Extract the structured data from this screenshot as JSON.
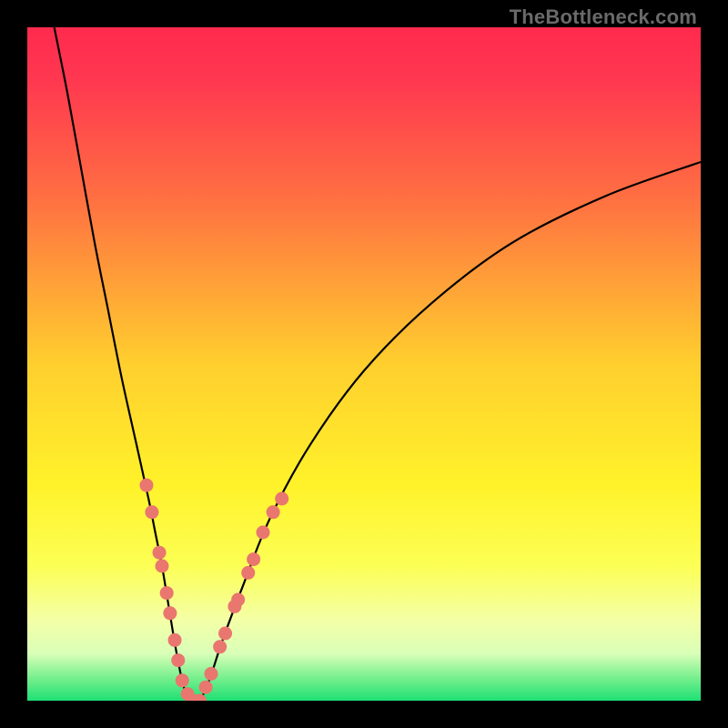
{
  "watermark": "TheBottleneck.com",
  "chart_data": {
    "type": "line",
    "title": "",
    "xlabel": "",
    "ylabel": "",
    "xlim": [
      0,
      100
    ],
    "ylim": [
      0,
      100
    ],
    "gradient_stops": [
      {
        "offset": 0,
        "color": "#ff2a4e"
      },
      {
        "offset": 0.08,
        "color": "#ff3850"
      },
      {
        "offset": 0.25,
        "color": "#ff6e42"
      },
      {
        "offset": 0.5,
        "color": "#ffcf2e"
      },
      {
        "offset": 0.68,
        "color": "#fff22a"
      },
      {
        "offset": 0.8,
        "color": "#fcff55"
      },
      {
        "offset": 0.88,
        "color": "#f4ffa6"
      },
      {
        "offset": 0.93,
        "color": "#d9ffb8"
      },
      {
        "offset": 0.965,
        "color": "#7af08f"
      },
      {
        "offset": 1.0,
        "color": "#1ee074"
      }
    ],
    "series": [
      {
        "name": "bottleneck-curve",
        "x": [
          4,
          6,
          8,
          10,
          12,
          14,
          16,
          18,
          19,
          20,
          21,
          22,
          23,
          24,
          25.5,
          27,
          29,
          32,
          36,
          42,
          50,
          60,
          72,
          86,
          100
        ],
        "values": [
          100,
          90,
          79,
          68,
          58,
          48,
          39,
          30,
          25,
          20,
          14,
          8,
          3,
          0,
          0,
          3,
          9,
          17,
          27,
          38,
          49,
          59,
          68,
          75,
          80
        ]
      }
    ],
    "highlight_dots": [
      {
        "x": 17.7,
        "y": 32
      },
      {
        "x": 18.5,
        "y": 28
      },
      {
        "x": 19.6,
        "y": 22
      },
      {
        "x": 20.0,
        "y": 20
      },
      {
        "x": 20.7,
        "y": 16
      },
      {
        "x": 21.2,
        "y": 13
      },
      {
        "x": 21.9,
        "y": 9
      },
      {
        "x": 22.4,
        "y": 6
      },
      {
        "x": 23.0,
        "y": 3
      },
      {
        "x": 23.8,
        "y": 1
      },
      {
        "x": 24.6,
        "y": 0
      },
      {
        "x": 25.6,
        "y": 0
      },
      {
        "x": 26.5,
        "y": 2
      },
      {
        "x": 27.3,
        "y": 4
      },
      {
        "x": 28.6,
        "y": 8
      },
      {
        "x": 29.4,
        "y": 10
      },
      {
        "x": 30.8,
        "y": 14
      },
      {
        "x": 31.3,
        "y": 15
      },
      {
        "x": 32.8,
        "y": 19
      },
      {
        "x": 33.6,
        "y": 21
      },
      {
        "x": 35.0,
        "y": 25
      },
      {
        "x": 36.5,
        "y": 28
      },
      {
        "x": 37.8,
        "y": 30
      }
    ]
  }
}
